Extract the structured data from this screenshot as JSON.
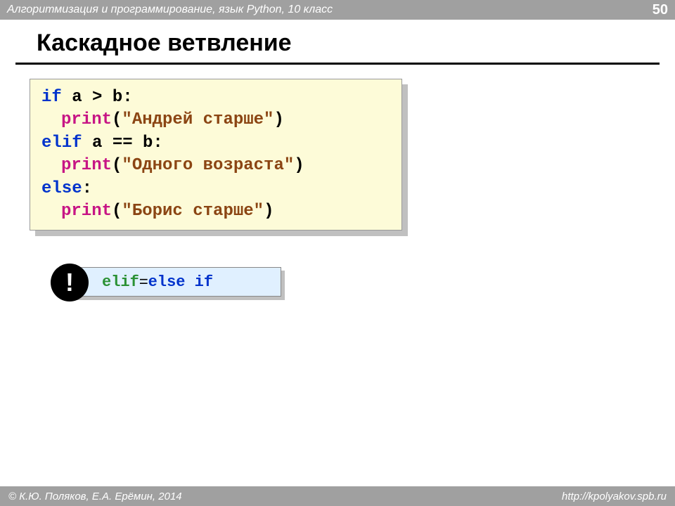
{
  "header": {
    "course": "Алгоритмизация и программирование, язык Python, 10 класс",
    "page_number": "50"
  },
  "title": "Каскадное ветвление",
  "code": {
    "line1_if": "if",
    "line1_cond": " a > b:",
    "line2_print": "print",
    "line2_paren_open": "(",
    "line2_str": "\"Андрей старше\"",
    "line2_paren_close": ")",
    "line3_elif": "elif",
    "line3_cond": " a == b:",
    "line4_print": "print",
    "line4_paren_open": "(",
    "line4_str": "\"Одного возраста\"",
    "line4_paren_close": ")",
    "line5_else": "else",
    "line5_colon": ":",
    "line6_print": "print",
    "line6_paren_open": "(",
    "line6_str": "\"Борис старше\"",
    "line6_paren_close": ")"
  },
  "note": {
    "exclaim": "!",
    "elif": "elif",
    "equals": " = ",
    "else_if": "else if"
  },
  "footer": {
    "copyright": "© К.Ю. Поляков, Е.А. Ерёмин, 2014",
    "url": "http://kpolyakov.spb.ru"
  }
}
